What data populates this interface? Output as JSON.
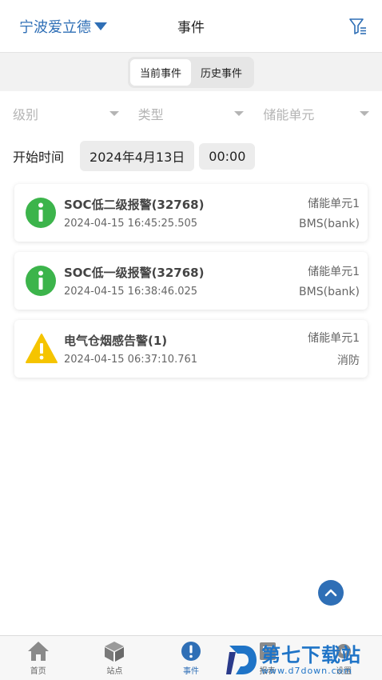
{
  "header": {
    "site": "宁波爱立德",
    "title": "事件"
  },
  "tabs": {
    "current": "当前事件",
    "history": "历史事件"
  },
  "filters": {
    "level": "级别",
    "type": "类型",
    "unit": "储能单元"
  },
  "time": {
    "label": "开始时间",
    "date": "2024年4月13日",
    "clock": "00:00"
  },
  "events": [
    {
      "title": "SOC低二级报警(32768)",
      "time": "2024-04-15 16:45:25.505",
      "unit": "储能单元1",
      "source": "BMS(bank)",
      "level": "info"
    },
    {
      "title": "SOC低一级报警(32768)",
      "time": "2024-04-15 16:38:46.025",
      "unit": "储能单元1",
      "source": "BMS(bank)",
      "level": "info"
    },
    {
      "title": "电气仓烟感告警(1)",
      "time": "2024-04-15 06:37:10.761",
      "unit": "储能单元1",
      "source": "消防",
      "level": "warning"
    }
  ],
  "tabbar": {
    "home": "首页",
    "site": "站点",
    "events": "事件",
    "report": "报表",
    "settings": "设置"
  },
  "watermark": {
    "title": "第七下载站",
    "url": "www.d7down.com"
  },
  "colors": {
    "accent": "#2f6fb6",
    "info": "#3cb44b",
    "warning": "#f5c400"
  }
}
